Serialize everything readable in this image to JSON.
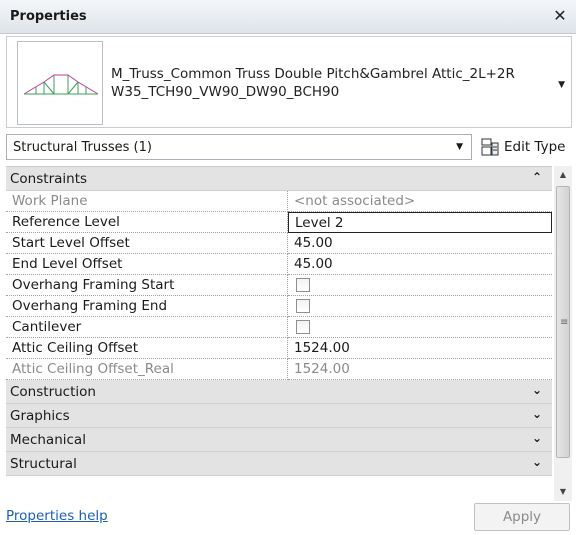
{
  "window": {
    "title": "Properties",
    "close_glyph": "✕"
  },
  "type_selector": {
    "line1": "M_Truss_Common Truss Double Pitch&Gambrel Attic_2L+2R",
    "line2": "W35_TCH90_VW90_DW90_BCH90",
    "dropdown_icon": "triangle-down-icon"
  },
  "instance_filter": {
    "label": "Structural Trusses (1)"
  },
  "edit_type": {
    "label": "Edit Type",
    "icon": "edit-type-icon"
  },
  "groups": {
    "constraints": "Constraints",
    "construction": "Construction",
    "graphics": "Graphics",
    "mechanical": "Mechanical",
    "structural": "Structural"
  },
  "properties": [
    {
      "name": "Work Plane",
      "value": "<not associated>",
      "disabled": true
    },
    {
      "name": "Reference Level",
      "value": "Level 2",
      "editing": true
    },
    {
      "name": "Start Level Offset",
      "value": "45.00"
    },
    {
      "name": "End Level Offset",
      "value": "45.00"
    },
    {
      "name": "Overhang Framing Start",
      "checkbox": false
    },
    {
      "name": "Overhang Framing End",
      "checkbox": false
    },
    {
      "name": "Cantilever",
      "checkbox": false
    },
    {
      "name": "Attic Ceiling Offset",
      "value": "1524.00"
    },
    {
      "name": "Attic Ceiling Offset_Real",
      "value": "1524.00",
      "disabled": true
    }
  ],
  "footer": {
    "help_link": "Properties help",
    "apply_label": "Apply"
  },
  "colors": {
    "link": "#1a5fb4",
    "group_bg": "#e3e3e3",
    "disabled_text": "#8a8a8a"
  }
}
